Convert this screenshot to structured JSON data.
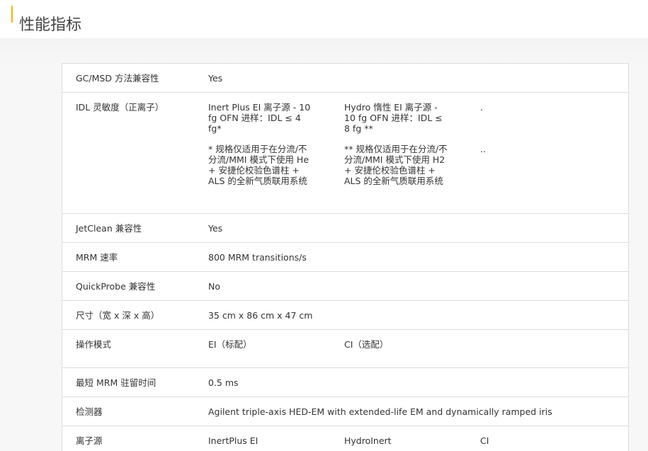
{
  "header": {
    "title": "性能指标",
    "accent_color": "#f4b400"
  },
  "specs": {
    "rows": [
      {
        "label": "GC/MSD 方法兼容性",
        "values": [
          "Yes"
        ]
      },
      {
        "label": "IDL 灵敏度（正离子）",
        "values": [
          "Inert Plus EI 离子源 - 10 fg OFN 进样：IDL ≤ 4 fg*",
          "Hydro 惰性 EI 离子源 - 10 fg OFN 进样：IDL ≤ 8 fg **",
          "."
        ],
        "notes": [
          "* 规格仅适用于在分流/不分流/MMI 模式下使用 He + 安捷伦校验色谱柱 + ALS 的全新气质联用系统",
          "** 规格仅适用于在分流/不分流/MMI 模式下使用 H2 + 安捷伦校验色谱柱 + ALS 的全新气质联用系统",
          ".."
        ]
      },
      {
        "label": "JetClean 兼容性",
        "values": [
          "Yes"
        ]
      },
      {
        "label": "MRM 速率",
        "values": [
          "800 MRM transitions/s"
        ]
      },
      {
        "label": "QuickProbe 兼容性",
        "values": [
          "No"
        ]
      },
      {
        "label": "尺寸（宽 x 深 x 高）",
        "values": [
          "35 cm x 86 cm x 47 cm"
        ]
      },
      {
        "label": "操作模式",
        "values": [
          "EI（标配）",
          "CI（选配）"
        ]
      },
      {
        "label": "最短 MRM 驻留时间",
        "values": [
          "0.5 ms"
        ]
      },
      {
        "label": "检测器",
        "values": [
          "Agilent triple-axis HED-EM with extended-life EM and dynamically ramped iris"
        ]
      },
      {
        "label": "离子源",
        "values": [
          "InertPlus EI",
          "HydroInert",
          "CI"
        ]
      }
    ]
  }
}
